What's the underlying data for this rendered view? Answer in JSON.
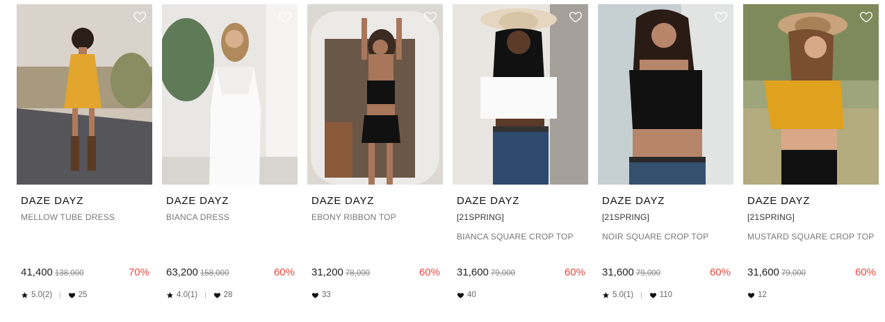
{
  "products": [
    {
      "brand": "DAZE DAYZ",
      "tag": "",
      "name": "MELLOW TUBE DRESS",
      "price": "41,400",
      "original_price": "138,000",
      "discount": "70%",
      "rating": "5.0(2)",
      "likes": "25"
    },
    {
      "brand": "DAZE DAYZ",
      "tag": "",
      "name": "BIANCA DRESS",
      "price": "63,200",
      "original_price": "158,000",
      "discount": "60%",
      "rating": "4.0(1)",
      "likes": "28"
    },
    {
      "brand": "DAZE DAYZ",
      "tag": "",
      "name": "EBONY RIBBON TOP",
      "price": "31,200",
      "original_price": "78,000",
      "discount": "60%",
      "rating": "",
      "likes": "33"
    },
    {
      "brand": "DAZE DAYZ",
      "tag": "[21SPRING]",
      "name": "BIANCA SQUARE CROP TOP",
      "price": "31,600",
      "original_price": "79,000",
      "discount": "60%",
      "rating": "",
      "likes": "40"
    },
    {
      "brand": "DAZE DAYZ",
      "tag": "[21SPRING]",
      "name": "NOIR SQUARE CROP TOP",
      "price": "31,600",
      "original_price": "79,000",
      "discount": "60%",
      "rating": "5.0(1)",
      "likes": "110"
    },
    {
      "brand": "DAZE DAYZ",
      "tag": "[21SPRING]",
      "name": "MUSTARD SQUARE CROP TOP",
      "price": "31,600",
      "original_price": "79,000",
      "discount": "60%",
      "rating": "",
      "likes": "12"
    }
  ],
  "colors": {
    "discount": "#e8483d",
    "text": "#222222",
    "muted": "#777777"
  },
  "icons": {
    "wishlist": "heart-outline-icon",
    "rating": "star-icon",
    "likes": "heart-icon"
  }
}
